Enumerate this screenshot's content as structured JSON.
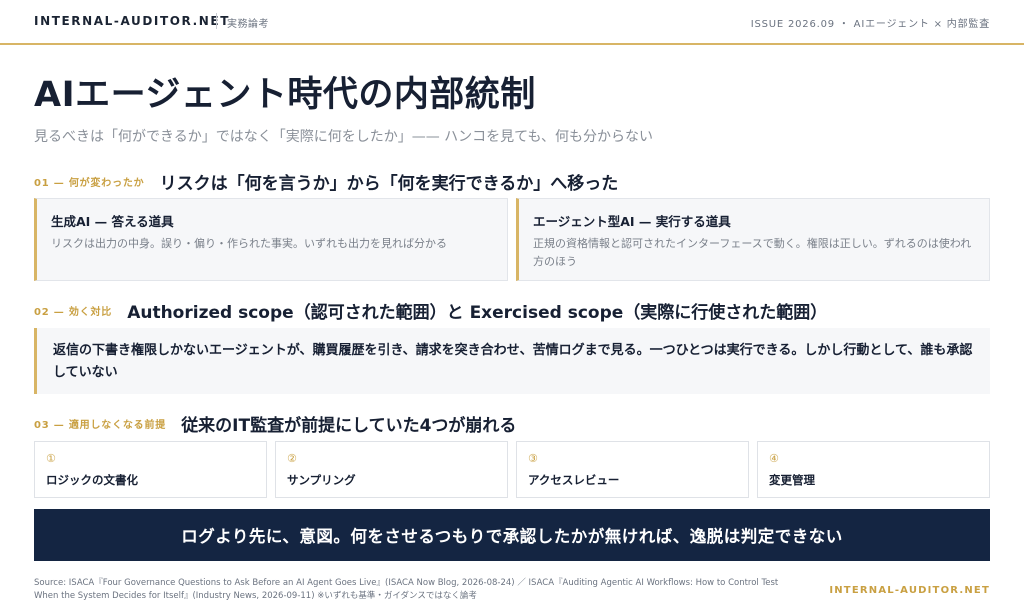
{
  "header": {
    "site_name": "INTERNAL-AUDITOR.NET",
    "tag": "実務論考",
    "issue": "ISSUE 2026.09 ・ AIエージェント × 内部監査"
  },
  "title": "AIエージェント時代の内部統制",
  "subtitle": "見るべきは「何ができるか」ではなく「実際に何をしたか」—— ハンコを見ても、何も分からない",
  "section1": {
    "label": "01 — 何が変わったか",
    "title": "リスクは「何を言うか」から「何を実行できるか」へ移った",
    "cards": [
      {
        "title": "生成AI — 答える道具",
        "desc": "リスクは出力の中身。誤り・偏り・作られた事実。いずれも出力を見れば分かる"
      },
      {
        "title": "エージェント型AI — 実行する道具",
        "desc": "正規の資格情報と認可されたインターフェースで動く。権限は正しい。ずれるのは使われ方のほう"
      }
    ]
  },
  "section2": {
    "label": "02 — 効く対比",
    "title": "Authorized scope（認可された範囲）と Exercised scope（実際に行使された範囲）",
    "quote": "返信の下書き権限しかないエージェントが、購買履歴を引き、請求を突き合わせ、苦情ログまで見る。一つひとつは実行できる。しかし行動として、誰も承認していない"
  },
  "section3": {
    "label": "03 — 適用しなくなる前提",
    "title": "従来のIT監査が前提にしていた4つが崩れる",
    "items": [
      {
        "num": "①",
        "label": "ロジックの文書化"
      },
      {
        "num": "②",
        "label": "サンプリング"
      },
      {
        "num": "③",
        "label": "アクセスレビュー"
      },
      {
        "num": "④",
        "label": "変更管理"
      }
    ]
  },
  "banner": "ログより先に、意図。何をさせるつもりで承認したかが無ければ、逸脱は判定できない",
  "footer": {
    "source": "Source: ISACA『Four Governance Questions to Ask Before an AI Agent Goes Live』(ISACA Now Blog, 2026-08-24) ／ ISACA『Auditing Agentic AI Workflows: How to Control Test When the System Decides for Itself』(Industry News, 2026-09-11) ※いずれも基準・ガイダンスではなく論考",
    "brand": "INTERNAL-AUDITOR.NET"
  },
  "colors": {
    "accent_gold": "#d8b565",
    "navy": "#142542",
    "text_dark": "#172033",
    "muted": "#8a9099"
  }
}
